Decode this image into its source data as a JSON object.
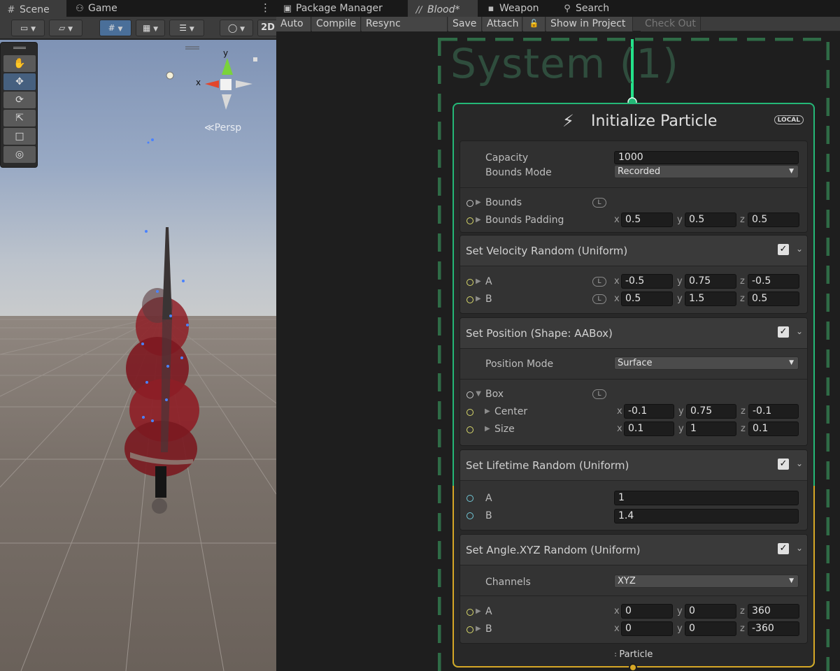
{
  "scene": {
    "tabs": [
      {
        "label": "Scene",
        "icon": "grid-icon"
      },
      {
        "label": "Game",
        "icon": "gamepad-icon"
      }
    ],
    "toolbar": {
      "mode_2d": "2D"
    },
    "gizmo": {
      "y_label": "y",
      "x_label": "x",
      "projection": "Persp"
    }
  },
  "vfx": {
    "tabs": [
      {
        "label": "Package Manager"
      },
      {
        "label": "Blood*"
      },
      {
        "label": "Weapon"
      },
      {
        "label": "Search"
      }
    ],
    "toolbar": {
      "auto": "Auto",
      "compile": "Compile",
      "resync": "Resync Material",
      "save": "Save",
      "attach": "Attach",
      "show_in_project": "Show in Project",
      "check_out": "Check Out"
    },
    "system_title": "System (1)",
    "context": {
      "title": "Initialize Particle",
      "badge": "LOCAL",
      "output_label": "Particle",
      "capacity_label": "Capacity",
      "capacity_value": "1000",
      "bounds_mode_label": "Bounds Mode",
      "bounds_mode_value": "Recorded",
      "bounds_label": "Bounds",
      "bounds_padding_label": "Bounds Padding",
      "bounds_padding": {
        "x": "0.5",
        "y": "0.5",
        "z": "0.5"
      }
    },
    "blocks": {
      "velocity": {
        "title": "Set Velocity Random (Uniform)",
        "a_label": "A",
        "a": {
          "x": "-0.5",
          "y": "0.75",
          "z": "-0.5"
        },
        "b_label": "B",
        "b": {
          "x": "0.5",
          "y": "1.5",
          "z": "0.5"
        }
      },
      "position": {
        "title": "Set Position (Shape: AABox)",
        "mode_label": "Position Mode",
        "mode_value": "Surface",
        "box_label": "Box",
        "center_label": "Center",
        "center": {
          "x": "-0.1",
          "y": "0.75",
          "z": "-0.1"
        },
        "size_label": "Size",
        "size": {
          "x": "0.1",
          "y": "1",
          "z": "0.1"
        }
      },
      "lifetime": {
        "title": "Set Lifetime Random (Uniform)",
        "a_label": "A",
        "a": "1",
        "b_label": "B",
        "b": "1.4"
      },
      "angle": {
        "title": "Set Angle.XYZ Random (Uniform)",
        "channels_label": "Channels",
        "channels_value": "XYZ",
        "a_label": "A",
        "a": {
          "x": "0",
          "y": "0",
          "z": "360"
        },
        "b_label": "B",
        "b": {
          "x": "0",
          "y": "0",
          "z": "-360"
        }
      }
    },
    "axis": {
      "x": "x",
      "y": "y",
      "z": "z"
    },
    "local_space_marker": "L"
  },
  "colors": {
    "context_border": "#24b877",
    "output_border": "#d6a726",
    "system_dash": "#2f6b46",
    "smoke": "#8e1e26"
  }
}
